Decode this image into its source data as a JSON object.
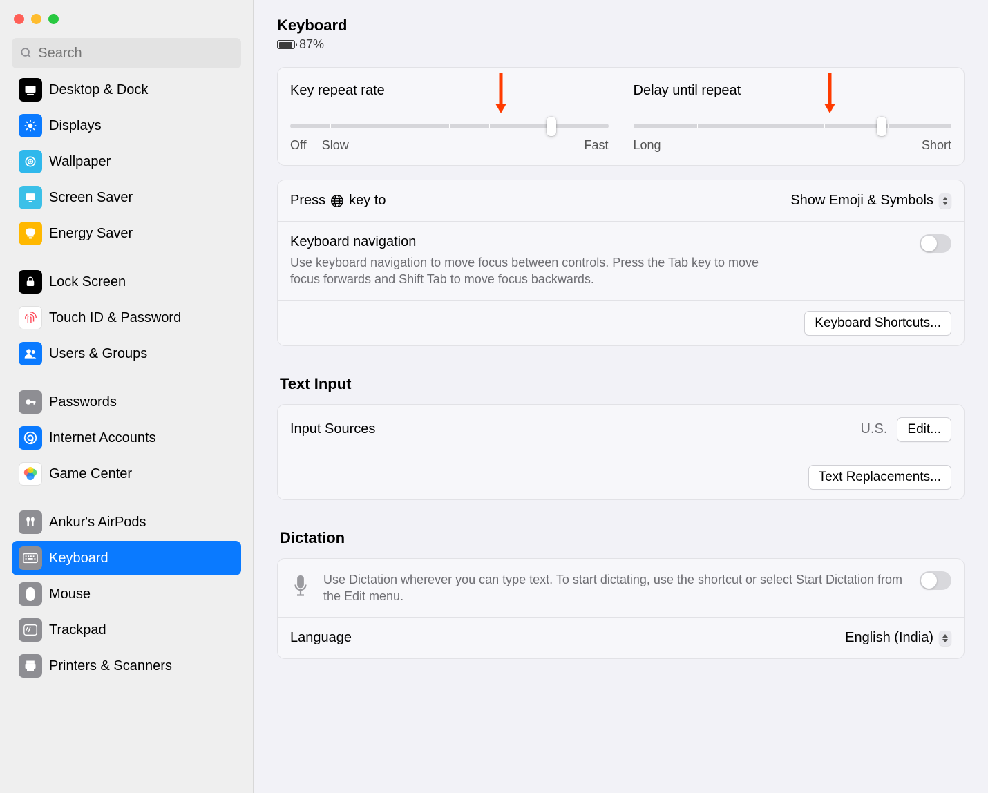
{
  "search": {
    "placeholder": "Search"
  },
  "sidebar": {
    "items": [
      {
        "label": "Desktop & Dock"
      },
      {
        "label": "Displays"
      },
      {
        "label": "Wallpaper"
      },
      {
        "label": "Screen Saver"
      },
      {
        "label": "Energy Saver"
      },
      {
        "label": "Lock Screen"
      },
      {
        "label": "Touch ID & Password"
      },
      {
        "label": "Users & Groups"
      },
      {
        "label": "Passwords"
      },
      {
        "label": "Internet Accounts"
      },
      {
        "label": "Game Center"
      },
      {
        "label": "Ankur's AirPods"
      },
      {
        "label": "Keyboard"
      },
      {
        "label": "Mouse"
      },
      {
        "label": "Trackpad"
      },
      {
        "label": "Printers & Scanners"
      }
    ]
  },
  "header": {
    "title": "Keyboard",
    "battery_pct": "87%"
  },
  "sliders": {
    "repeat_rate": {
      "label": "Key repeat rate",
      "left1": "Off",
      "left2": "Slow",
      "right": "Fast"
    },
    "delay": {
      "label": "Delay until repeat",
      "left": "Long",
      "right": "Short"
    }
  },
  "settings": {
    "press_globe_label": "Press 🌐 key to",
    "press_globe_prefix": "Press",
    "press_globe_suffix": "key to",
    "press_globe_value": "Show Emoji & Symbols",
    "kb_nav_title": "Keyboard navigation",
    "kb_nav_desc": "Use keyboard navigation to move focus between controls. Press the Tab key to move focus forwards and Shift Tab to move focus backwards.",
    "kb_shortcuts_btn": "Keyboard Shortcuts..."
  },
  "text_input": {
    "section_title": "Text Input",
    "input_sources_label": "Input Sources",
    "input_sources_value": "U.S.",
    "edit_btn": "Edit...",
    "replacements_btn": "Text Replacements..."
  },
  "dictation": {
    "section_title": "Dictation",
    "desc": "Use Dictation wherever you can type text. To start dictating, use the shortcut or select Start Dictation from the Edit menu.",
    "language_label": "Language",
    "language_value": "English (India)"
  }
}
